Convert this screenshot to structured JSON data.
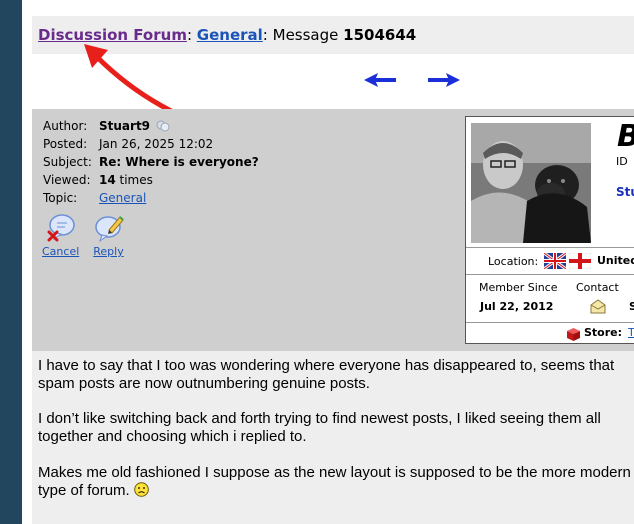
{
  "breadcrumb": {
    "forum_link": "Discussion Forum",
    "sep1": ":",
    "category_link": "General",
    "sep2": ":",
    "message_label": " Message ",
    "message_id": "1504644"
  },
  "message_meta": {
    "author_label": "Author:",
    "author": "Stuart9",
    "posted_label": "Posted:",
    "posted": "Jan 26, 2025 12:02",
    "subject_label": "Subject:",
    "subject": "Re: Where is everyone?",
    "viewed_label": "Viewed:",
    "views": "14",
    "views_suffix": " times",
    "topic_label": "Topic:",
    "topic": "General"
  },
  "actions": {
    "cancel": "Cancel",
    "reply": "Reply"
  },
  "profile": {
    "name_partial": "B",
    "id_label": "ID",
    "username_partial": "Stu",
    "location_label": "Location:",
    "location_value": "United",
    "member_since_label": "Member Since",
    "member_since": "Jul 22, 2012",
    "contact_label": "Contact",
    "extra_char": "S",
    "store_label": "Store:",
    "store_link": "T"
  },
  "post_body": {
    "p1": "I have to say that I too was wondering where everyone has disappeared to, seems that spam posts are now outnumbering genuine posts.",
    "p2": "I don’t like switching back and forth trying to find newest posts, I liked seeing them all together and choosing which i replied to.",
    "p3": "Makes me old fashioned I suppose as the new layout is supposed to be the more modern type of forum."
  },
  "colors": {
    "outer_bg": "#23465f",
    "link": "#1a54b8",
    "visited_link": "#6a2c8c",
    "annotation_arrow": "#e8201c",
    "nav_arrow": "#1a2fd8"
  }
}
